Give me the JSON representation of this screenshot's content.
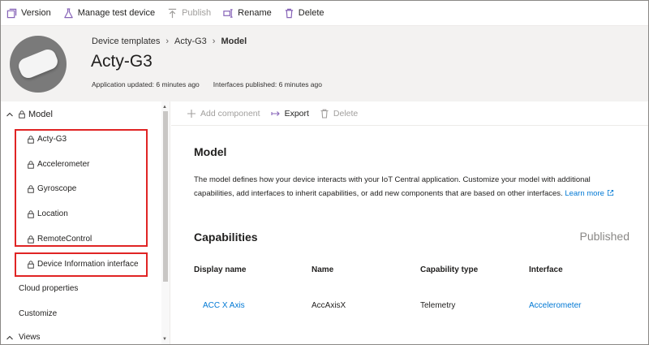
{
  "toolbar": {
    "version": "Version",
    "manage_test_device": "Manage test device",
    "publish": "Publish",
    "rename": "Rename",
    "delete": "Delete"
  },
  "header": {
    "breadcrumb": [
      "Device templates",
      "Acty-G3",
      "Model"
    ],
    "title": "Acty-G3",
    "app_updated": "Application updated: 6 minutes ago",
    "interfaces_published": "Interfaces published: 6 minutes ago"
  },
  "sidebar": {
    "model_label": "Model",
    "components": [
      "Acty-G3",
      "Accelerometer",
      "Gyroscope",
      "Location",
      "RemoteControl"
    ],
    "device_info": "Device Information interface",
    "cloud_properties": "Cloud properties",
    "customize": "Customize",
    "views": "Views"
  },
  "commands": {
    "add_component": "Add component",
    "export": "Export",
    "delete": "Delete"
  },
  "model": {
    "title": "Model",
    "description": "The model defines how your device interacts with your IoT Central application. Customize your model with additional capabilities, add interfaces to inherit capabilities, or add new components that are based on other interfaces.",
    "learn_more": "Learn more"
  },
  "capabilities": {
    "title": "Capabilities",
    "status": "Published",
    "columns": [
      "Display name",
      "Name",
      "Capability type",
      "Interface"
    ],
    "rows": [
      {
        "display_name": "ACC X Axis",
        "name": "AccAxisX",
        "type": "Telemetry",
        "interface": "Accelerometer"
      }
    ]
  },
  "colors": {
    "accent": "#0078d4",
    "highlight": "#e02424",
    "icon_purple": "#8764b8"
  }
}
